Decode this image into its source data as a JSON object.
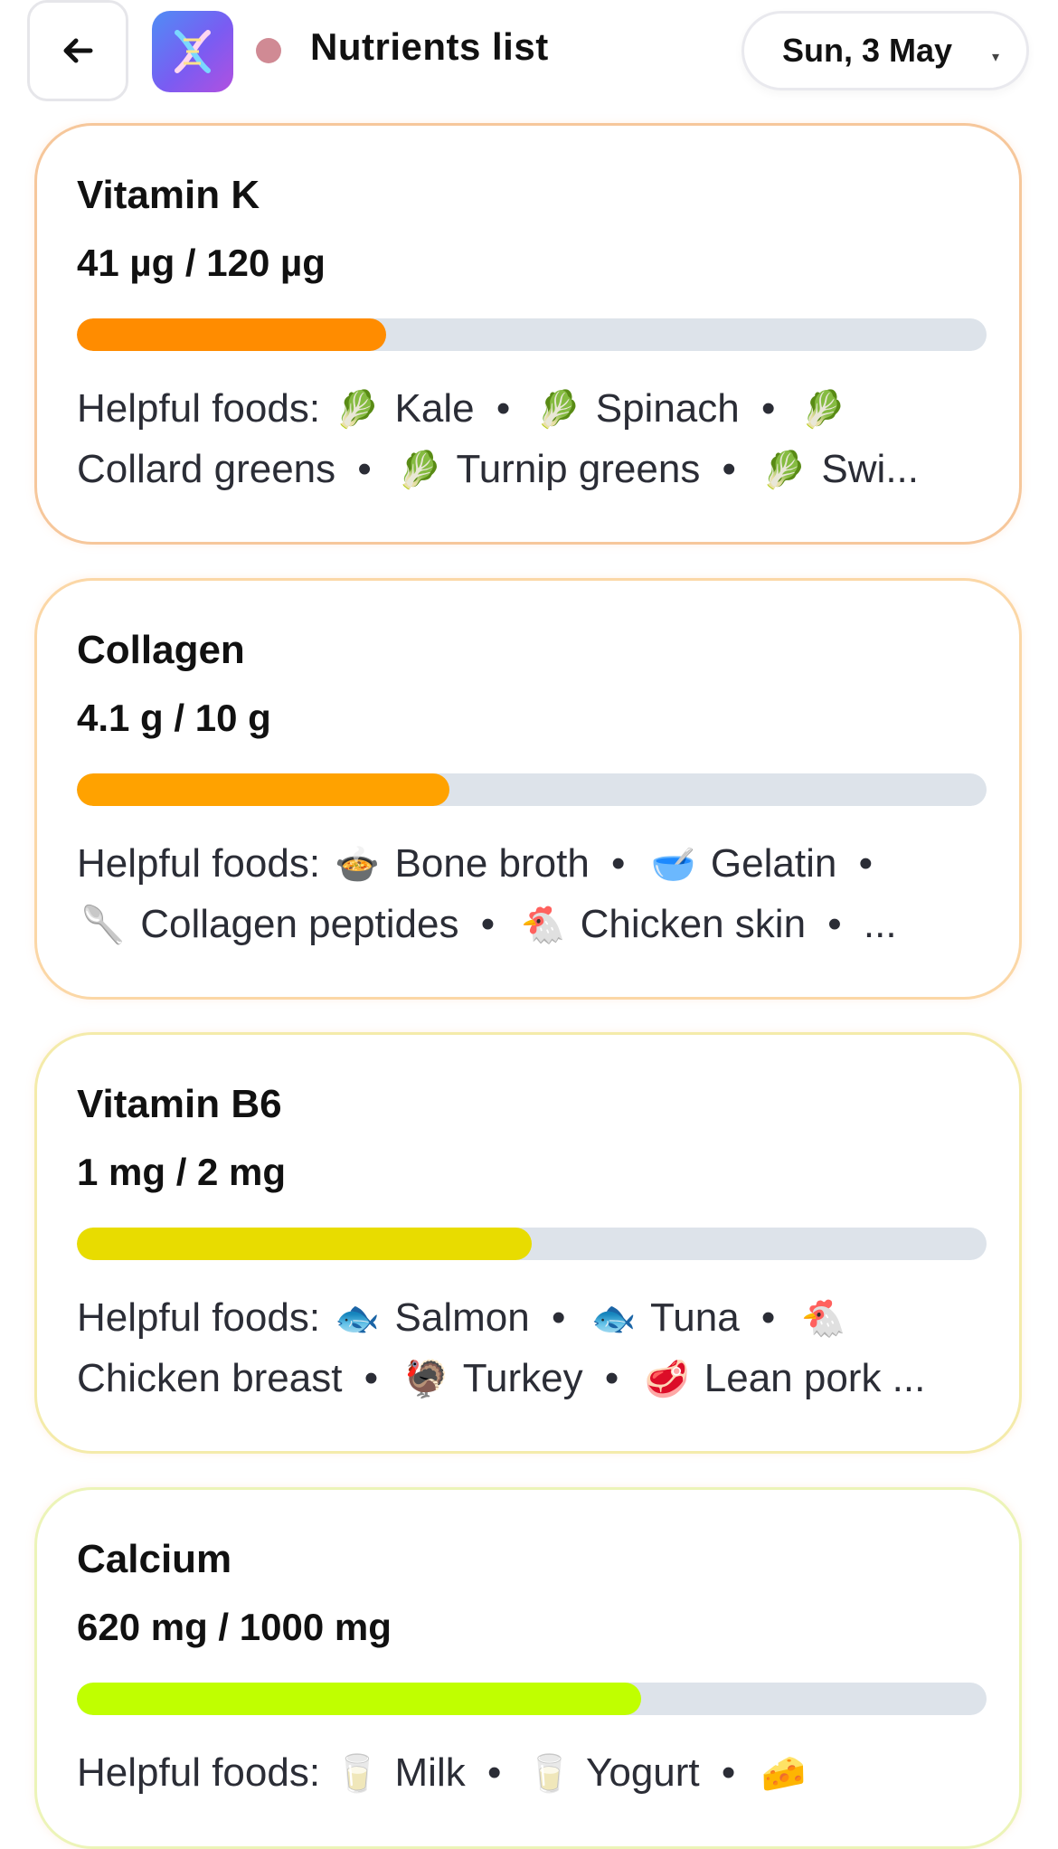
{
  "header": {
    "title": "Nutrients list",
    "date": "Sun, 3 May",
    "caret": "▾"
  },
  "nutrients": [
    {
      "name": "Vitamin K",
      "amount": "41 µg / 120 µg",
      "progress": 0.34,
      "bar_color": "#ff8c00",
      "border_color": "#f6c79b",
      "foods_line1": [
        "Helpful foods:",
        "🥬",
        "Kale",
        "•",
        "🥬",
        "Spinach",
        "•",
        "🥬"
      ],
      "foods_line2": [
        "Collard greens",
        "•",
        "🥬",
        "Turnip greens",
        "•",
        "🥬",
        "Swi..."
      ]
    },
    {
      "name": "Collagen",
      "amount": "4.1 g / 10 g",
      "progress": 0.41,
      "bar_color": "#ffa200",
      "border_color": "#fbd7a6",
      "foods_line1": [
        "Helpful foods:",
        "🍲",
        "Bone broth",
        "•",
        "🥣",
        "Gelatin",
        "•"
      ],
      "foods_line2": [
        "🥄",
        "Collagen peptides",
        "•",
        "🐔",
        "Chicken skin",
        "•",
        "..."
      ]
    },
    {
      "name": "Vitamin B6",
      "amount": "1 mg / 2 mg",
      "progress": 0.5,
      "bar_color": "#e8dc00",
      "border_color": "#f4ebaa",
      "foods_line1": [
        "Helpful foods:",
        "🐟",
        "Salmon",
        "•",
        "🐟",
        "Tuna",
        "•",
        "🐔"
      ],
      "foods_line2": [
        "Chicken breast",
        "•",
        "🦃",
        "Turkey",
        "•",
        "🥩",
        "Lean pork ..."
      ]
    },
    {
      "name": "Calcium",
      "amount": "620 mg / 1000 mg",
      "progress": 0.62,
      "bar_color": "#c0ff00",
      "border_color": "#ecf4b8",
      "foods_line1": [
        "Helpful foods:",
        "🥛",
        "Milk",
        "•",
        "🥛",
        "Yogurt",
        "•",
        "🧀"
      ],
      "foods_line2": []
    }
  ]
}
